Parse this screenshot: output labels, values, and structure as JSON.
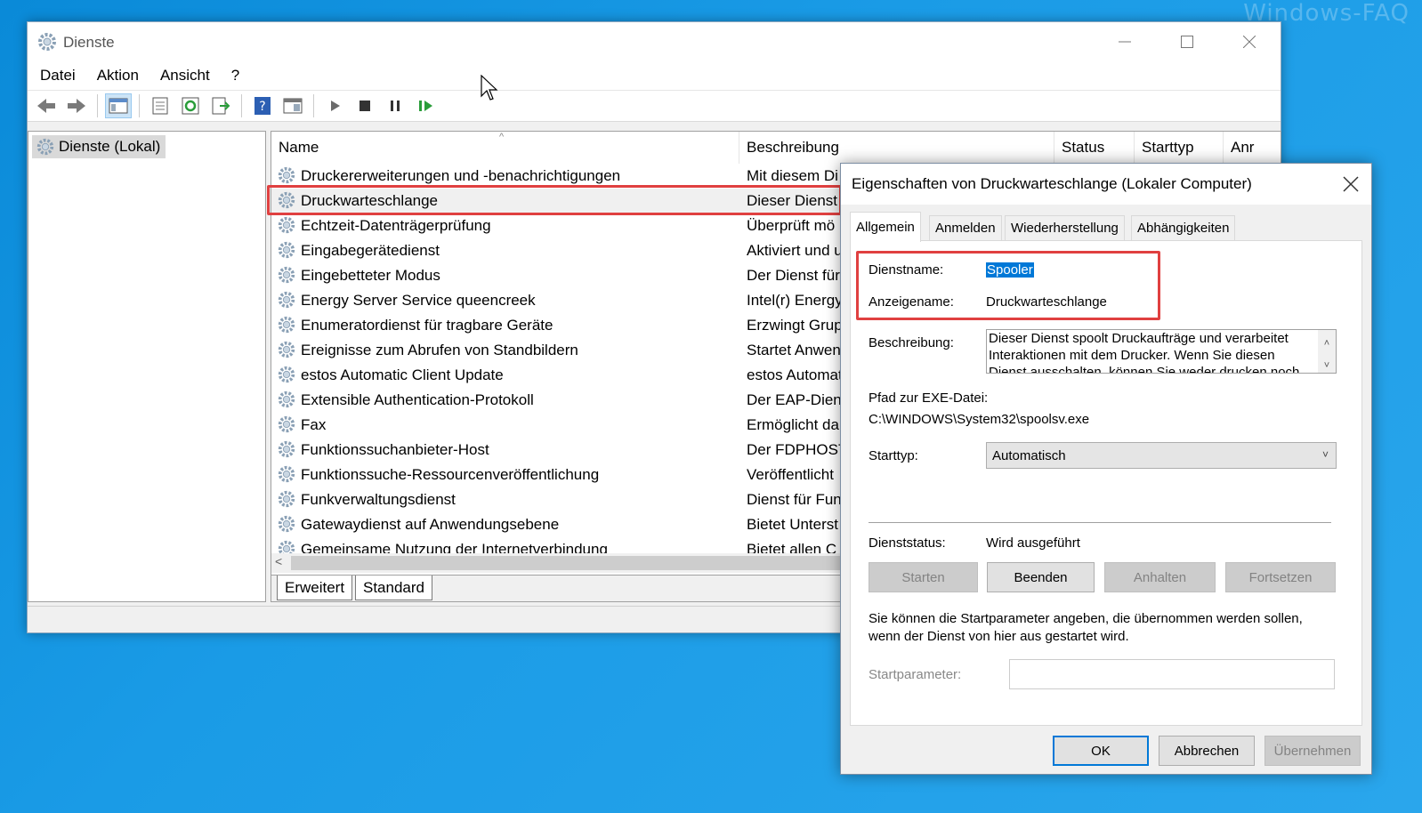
{
  "watermark": "Windows-FAQ",
  "window": {
    "title": "Dienste",
    "menu": [
      "Datei",
      "Aktion",
      "Ansicht",
      "?"
    ]
  },
  "tree": {
    "root": "Dienste (Lokal)"
  },
  "list": {
    "columns": [
      "Name",
      "Beschreibung",
      "Status",
      "Starttyp",
      "Anr"
    ],
    "rows": [
      {
        "name": "Druckererweiterungen und -benachrichtigungen",
        "desc": "Mit diesem Di"
      },
      {
        "name": "Druckwarteschlange",
        "desc": "Dieser Dienst"
      },
      {
        "name": "Echtzeit-Datenträgerprüfung",
        "desc": "Überprüft mö"
      },
      {
        "name": "Eingabegerätedienst",
        "desc": "Aktiviert und u"
      },
      {
        "name": "Eingebetteter Modus",
        "desc": "Der Dienst für"
      },
      {
        "name": "Energy Server Service queencreek",
        "desc": "Intel(r) Energy"
      },
      {
        "name": "Enumeratordienst für tragbare Geräte",
        "desc": "Erzwingt Grup"
      },
      {
        "name": "Ereignisse zum Abrufen von Standbildern",
        "desc": "Startet Anwen"
      },
      {
        "name": "estos Automatic Client Update",
        "desc": "estos Automat"
      },
      {
        "name": "Extensible Authentication-Protokoll",
        "desc": "Der EAP-Diens"
      },
      {
        "name": "Fax",
        "desc": "Ermöglicht da"
      },
      {
        "name": "Funktionssuchanbieter-Host",
        "desc": "Der FDPHOST-"
      },
      {
        "name": "Funktionssuche-Ressourcenveröffentlichung",
        "desc": "Veröffentlicht"
      },
      {
        "name": "Funkverwaltungsdienst",
        "desc": "Dienst für Fun"
      },
      {
        "name": "Gatewaydienst auf Anwendungsebene",
        "desc": "Bietet Unterst"
      },
      {
        "name": "Gemeinsame Nutzung der Internetverbindung",
        "desc": "Bietet allen C"
      }
    ],
    "tabs": [
      "Erweitert",
      "Standard"
    ]
  },
  "dialog": {
    "title": "Eigenschaften von Druckwarteschlange (Lokaler Computer)",
    "tabs": [
      "Allgemein",
      "Anmelden",
      "Wiederherstellung",
      "Abhängigkeiten"
    ],
    "service_name_label": "Dienstname:",
    "service_name": "Spooler",
    "display_name_label": "Anzeigename:",
    "display_name": "Druckwarteschlange",
    "description_label": "Beschreibung:",
    "description_lines": [
      "Dieser Dienst spoolt Druckaufträge und verarbeitet",
      "Interaktionen mit dem Drucker. Wenn Sie diesen",
      "Dienst ausschalten, können Sie weder drucken noch"
    ],
    "exe_path_label": "Pfad zur EXE-Datei:",
    "exe_path": "C:\\WINDOWS\\System32\\spoolsv.exe",
    "starttype_label": "Starttyp:",
    "starttype": "Automatisch",
    "status_label": "Dienststatus:",
    "status": "Wird ausgeführt",
    "btn_start": "Starten",
    "btn_stop": "Beenden",
    "btn_pause": "Anhalten",
    "btn_resume": "Fortsetzen",
    "hint": "Sie können die Startparameter angeben, die übernommen werden sollen,",
    "hint2": "wenn der Dienst von hier aus gestartet wird.",
    "param_label": "Startparameter:",
    "ok": "OK",
    "cancel": "Abbrechen",
    "apply": "Übernehmen"
  }
}
